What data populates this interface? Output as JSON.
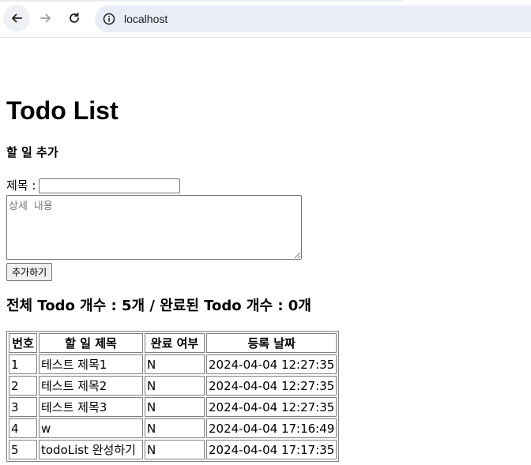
{
  "browser": {
    "url": "localhost"
  },
  "page": {
    "title": "Todo List",
    "add_section_title": "할 일 추가",
    "form": {
      "title_label": "제목 :",
      "title_value": "",
      "detail_placeholder": "상세 내용",
      "add_button": "추가하기"
    },
    "summary": {
      "total_label": "전체 Todo 개수 : ",
      "total_value": "5개",
      "separator": " / ",
      "done_label": "완료된 Todo 개수 : ",
      "done_value": "0개"
    },
    "table": {
      "headers": [
        "번호",
        "할 일 제목",
        "완료 여부",
        "등록 날짜"
      ],
      "rows": [
        [
          "1",
          "테스트 제목1",
          "N",
          "2024-04-04 12:27:35"
        ],
        [
          "2",
          "테스트 제목2",
          "N",
          "2024-04-04 12:27:35"
        ],
        [
          "3",
          "테스트 제목3",
          "N",
          "2024-04-04 12:27:35"
        ],
        [
          "4",
          "w",
          "N",
          "2024-04-04 17:16:49"
        ],
        [
          "5",
          "todoList 완성하기",
          "N",
          "2024-04-04 17:17:35"
        ]
      ]
    }
  }
}
